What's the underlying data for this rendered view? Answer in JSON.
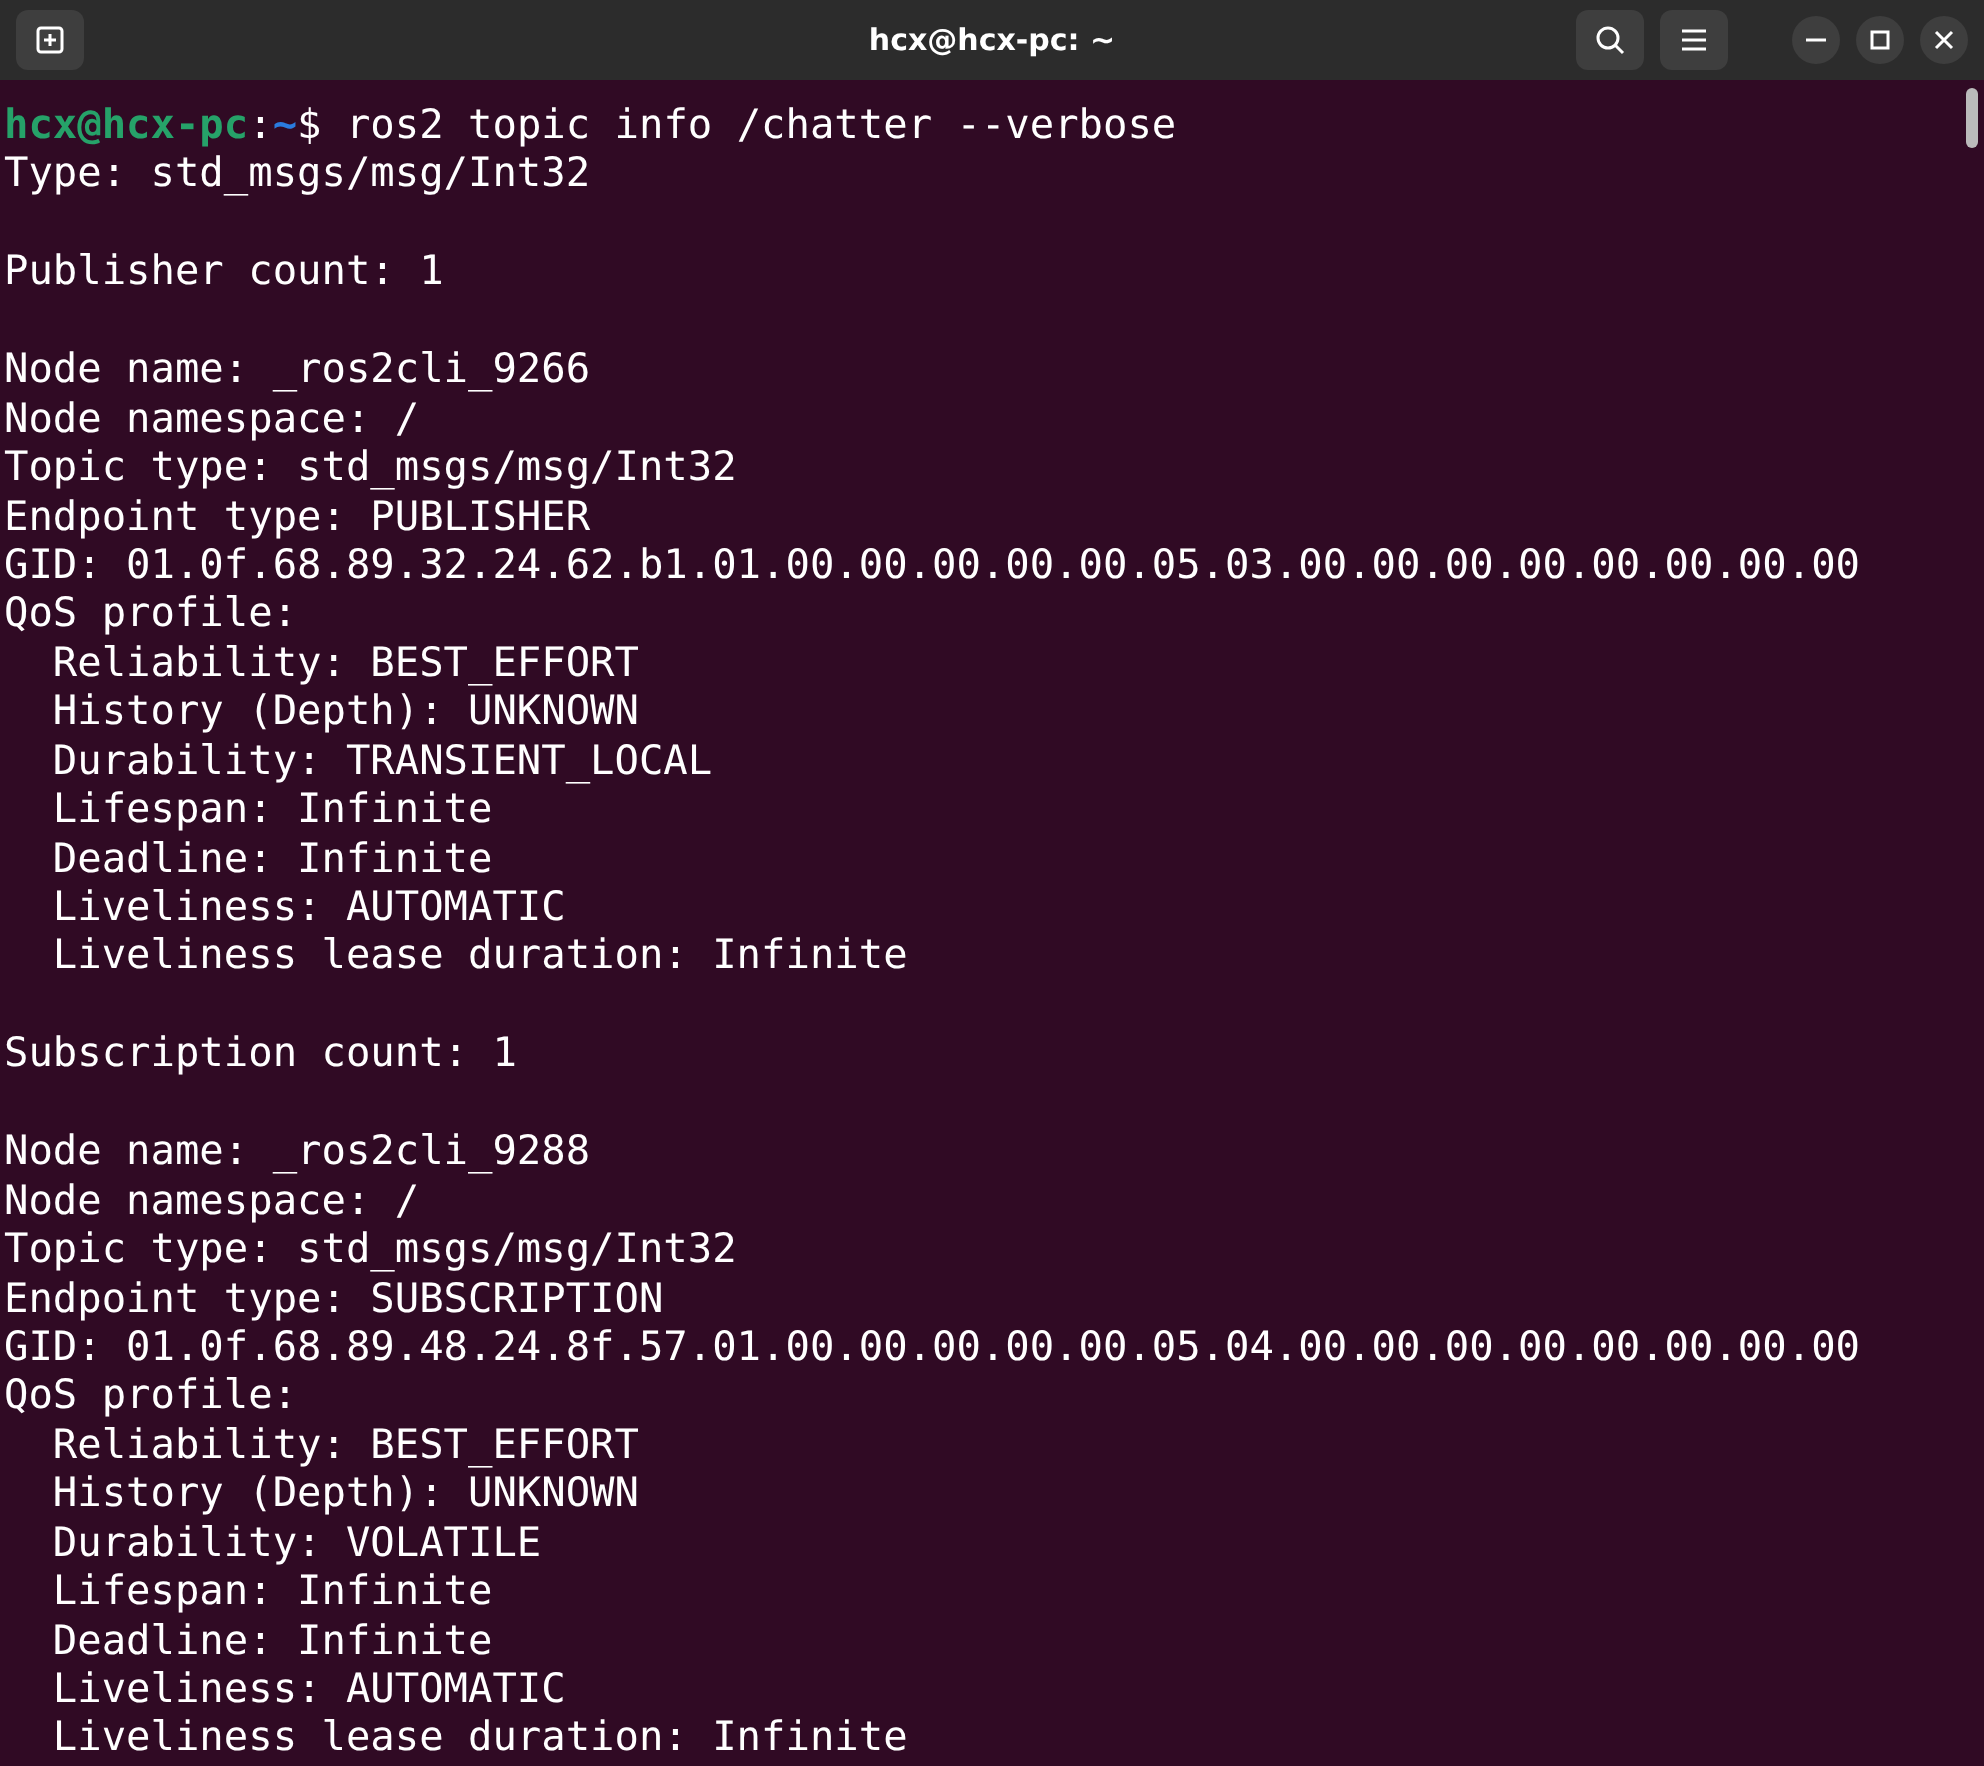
{
  "window": {
    "title": "hcx@hcx-pc: ~"
  },
  "terminal": {
    "lines": [
      {
        "kind": "prompt",
        "user": "hcx@hcx-pc",
        "colon": ":",
        "path": "~",
        "symbol": "$",
        "command": " ros2 topic info /chatter --verbose"
      },
      {
        "kind": "text",
        "text": "Type: std_msgs/msg/Int32"
      },
      {
        "kind": "blank"
      },
      {
        "kind": "text",
        "text": "Publisher count: 1"
      },
      {
        "kind": "blank"
      },
      {
        "kind": "text",
        "text": "Node name: _ros2cli_9266"
      },
      {
        "kind": "text",
        "text": "Node namespace: /"
      },
      {
        "kind": "text",
        "text": "Topic type: std_msgs/msg/Int32"
      },
      {
        "kind": "text",
        "text": "Endpoint type: PUBLISHER"
      },
      {
        "kind": "text",
        "text": "GID: 01.0f.68.89.32.24.62.b1.01.00.00.00.00.00.05.03.00.00.00.00.00.00.00.00"
      },
      {
        "kind": "text",
        "text": "QoS profile:"
      },
      {
        "kind": "text",
        "text": "  Reliability: BEST_EFFORT"
      },
      {
        "kind": "text",
        "text": "  History (Depth): UNKNOWN"
      },
      {
        "kind": "text",
        "text": "  Durability: TRANSIENT_LOCAL"
      },
      {
        "kind": "text",
        "text": "  Lifespan: Infinite"
      },
      {
        "kind": "text",
        "text": "  Deadline: Infinite"
      },
      {
        "kind": "text",
        "text": "  Liveliness: AUTOMATIC"
      },
      {
        "kind": "text",
        "text": "  Liveliness lease duration: Infinite"
      },
      {
        "kind": "blank"
      },
      {
        "kind": "text",
        "text": "Subscription count: 1"
      },
      {
        "kind": "blank"
      },
      {
        "kind": "text",
        "text": "Node name: _ros2cli_9288"
      },
      {
        "kind": "text",
        "text": "Node namespace: /"
      },
      {
        "kind": "text",
        "text": "Topic type: std_msgs/msg/Int32"
      },
      {
        "kind": "text",
        "text": "Endpoint type: SUBSCRIPTION"
      },
      {
        "kind": "text",
        "text": "GID: 01.0f.68.89.48.24.8f.57.01.00.00.00.00.00.05.04.00.00.00.00.00.00.00.00"
      },
      {
        "kind": "text",
        "text": "QoS profile:"
      },
      {
        "kind": "text",
        "text": "  Reliability: BEST_EFFORT"
      },
      {
        "kind": "text",
        "text": "  History (Depth): UNKNOWN"
      },
      {
        "kind": "text",
        "text": "  Durability: VOLATILE"
      },
      {
        "kind": "text",
        "text": "  Lifespan: Infinite"
      },
      {
        "kind": "text",
        "text": "  Deadline: Infinite"
      },
      {
        "kind": "text",
        "text": "  Liveliness: AUTOMATIC"
      },
      {
        "kind": "text",
        "text": "  Liveliness lease duration: Infinite"
      }
    ]
  }
}
